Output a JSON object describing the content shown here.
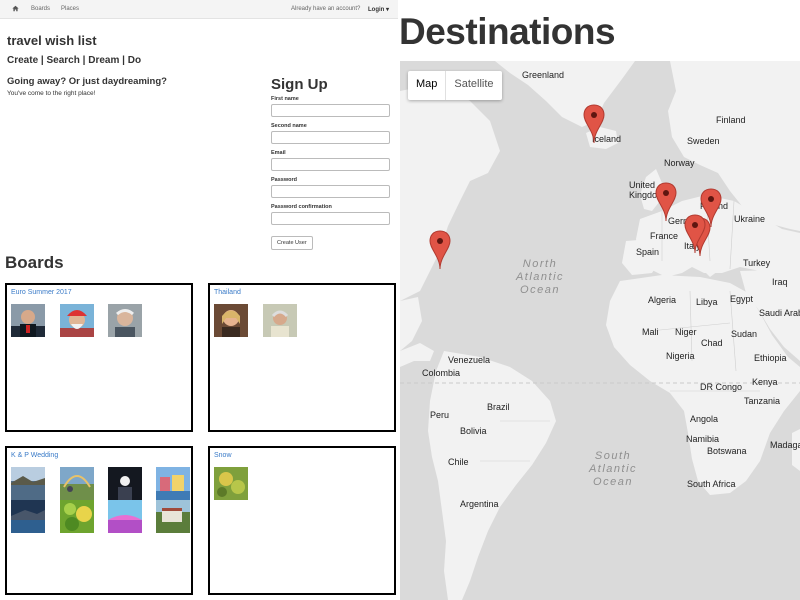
{
  "navbar": {
    "home_icon": "home-icon",
    "boards_link": "Boards",
    "places_link": "Places",
    "account_text": "Already have an account?",
    "login_label": "Login ▾"
  },
  "app": {
    "title": "travel wish list",
    "menu": [
      "Create",
      "Search",
      "Dream",
      "Do"
    ],
    "tagline": "Going away? Or just daydreaming?",
    "subtagline": "You've come to the right place!"
  },
  "signup": {
    "title": "Sign Up",
    "fields": [
      {
        "label": "First name",
        "value": ""
      },
      {
        "label": "Second name",
        "value": ""
      },
      {
        "label": "Email",
        "value": ""
      },
      {
        "label": "Password",
        "value": ""
      },
      {
        "label": "Password confirmation",
        "value": ""
      }
    ],
    "submit_label": "Create User"
  },
  "boards": {
    "heading": "Boards",
    "items": [
      {
        "title": "Euro Summer 2017",
        "thumb_count": 3
      },
      {
        "title": "Thailand",
        "thumb_count": 2
      },
      {
        "title": "K & P Wedding",
        "thumb_count": 8
      },
      {
        "title": "Snow",
        "thumb_count": 1
      }
    ]
  },
  "destinations": {
    "title": "Destinations",
    "map_type_options": [
      "Map",
      "Satellite"
    ],
    "selected_map_type": "Map",
    "labels": {
      "greenland": "Greenland",
      "iceland": "Iceland",
      "finland": "Finland",
      "sweden": "Sweden",
      "norway": "Norway",
      "united_kingdom": "United Kingdom",
      "germany": "Germany",
      "poland": "Poland",
      "ukraine": "Ukraine",
      "france": "France",
      "italy": "Italy",
      "spain": "Spain",
      "turkey": "Turkey",
      "iraq": "Iraq",
      "algeria": "Algeria",
      "libya": "Libya",
      "egypt": "Egypt",
      "saudi_arabia": "Saudi Arab",
      "mali": "Mali",
      "niger": "Niger",
      "sudan": "Sudan",
      "chad": "Chad",
      "nigeria": "Nigeria",
      "ethiopia": "Ethiopia",
      "venezuela": "Venezuela",
      "colombia": "Colombia",
      "dr_congo": "DR Congo",
      "kenya": "Kenya",
      "tanzania": "Tanzania",
      "peru": "Peru",
      "brazil": "Brazil",
      "bolivia": "Bolivia",
      "angola": "Angola",
      "namibia": "Namibia",
      "botswana": "Botswana",
      "madagascar": "Madaga",
      "chile": "Chile",
      "argentina": "Argentina",
      "south_africa": "South Africa",
      "north_atlantic": "North Atlantic Ocean",
      "south_atlantic": "South Atlantic Ocean"
    },
    "pins": [
      "Iceland",
      "United Kingdom",
      "Poland",
      "Italy",
      "Italy",
      "United States East Coast"
    ],
    "colors": {
      "land": "#f2f2f2",
      "water": "#dadada",
      "pin": "#e05446"
    }
  }
}
